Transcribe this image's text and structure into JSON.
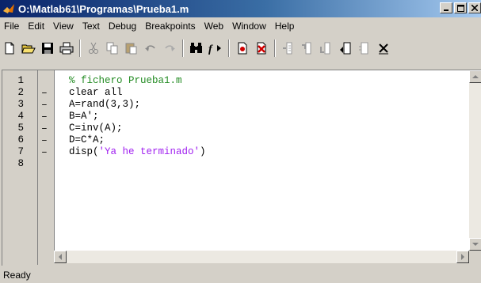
{
  "window": {
    "title": "O:\\Matlab61\\Programas\\Prueba1.m",
    "app_icon": "matlab-logo-icon",
    "controls": [
      "minimize-icon",
      "maximize-icon",
      "close-icon"
    ]
  },
  "menu": {
    "items": [
      "File",
      "Edit",
      "View",
      "Text",
      "Debug",
      "Breakpoints",
      "Web",
      "Window",
      "Help"
    ]
  },
  "toolbar": {
    "buttons": [
      {
        "icon": "new-file-icon"
      },
      {
        "icon": "open-folder-icon"
      },
      {
        "icon": "save-icon"
      },
      {
        "icon": "print-icon"
      },
      {
        "icon": "cut-icon"
      },
      {
        "icon": "copy-icon"
      },
      {
        "icon": "paste-icon"
      },
      {
        "icon": "undo-icon"
      },
      {
        "icon": "redo-icon"
      },
      {
        "icon": "find-icon"
      },
      {
        "icon": "function-icon"
      },
      {
        "icon": "set-breakpoint-icon"
      },
      {
        "icon": "clear-breakpoints-icon"
      },
      {
        "icon": "step-icon"
      },
      {
        "icon": "step-in-icon"
      },
      {
        "icon": "step-out-icon"
      },
      {
        "icon": "continue-icon"
      },
      {
        "icon": "stack-icon"
      },
      {
        "icon": "exit-debug-icon"
      }
    ]
  },
  "editor": {
    "line_numbers": [
      "1",
      "2",
      "3",
      "4",
      "5",
      "6",
      "7",
      "8"
    ],
    "breakpoint_markers": [
      "",
      "–",
      "–",
      "–",
      "–",
      "–",
      "–",
      ""
    ],
    "lines": [
      {
        "text": "% fichero Prueba1.m",
        "kind": "comment"
      },
      {
        "text": "clear all",
        "kind": "code"
      },
      {
        "text": "A=rand(3,3);",
        "kind": "code"
      },
      {
        "text": "B=A';",
        "kind": "code"
      },
      {
        "text": "C=inv(A);",
        "kind": "code"
      },
      {
        "text": "D=C*A;",
        "kind": "code"
      },
      {
        "text": "disp(",
        "kind": "code",
        "string": "'Ya he terminado'",
        "after": ")"
      },
      {
        "text": "",
        "kind": "code"
      }
    ],
    "colors": {
      "comment": "#228b22",
      "string": "#a020f0",
      "code": "#000000"
    }
  },
  "status": {
    "text": "Ready"
  }
}
